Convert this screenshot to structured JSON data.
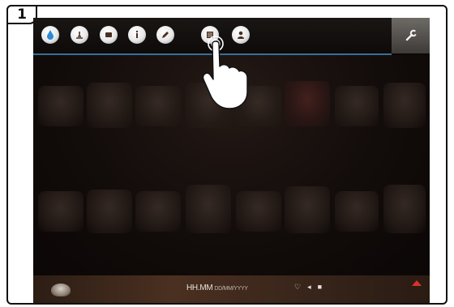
{
  "step": {
    "number": "1"
  },
  "toolbar": {
    "icons": [
      "water-drop-icon",
      "temperature-icon",
      "cup-icon",
      "info-icon",
      "pencil-icon",
      "menu-book-icon",
      "user-profile-icon"
    ],
    "settings_icon": "wrench-icon",
    "accent": "#3a6f95"
  },
  "statusbar": {
    "time": "HH.MM",
    "date": "DD/MM/YYYY",
    "indicators": [
      "heart-icon",
      "sound-icon",
      "lock-icon"
    ]
  },
  "colors": {
    "background": "#0c0806",
    "accent_blue": "#2a8ad8",
    "alert_red": "#d8322b"
  }
}
